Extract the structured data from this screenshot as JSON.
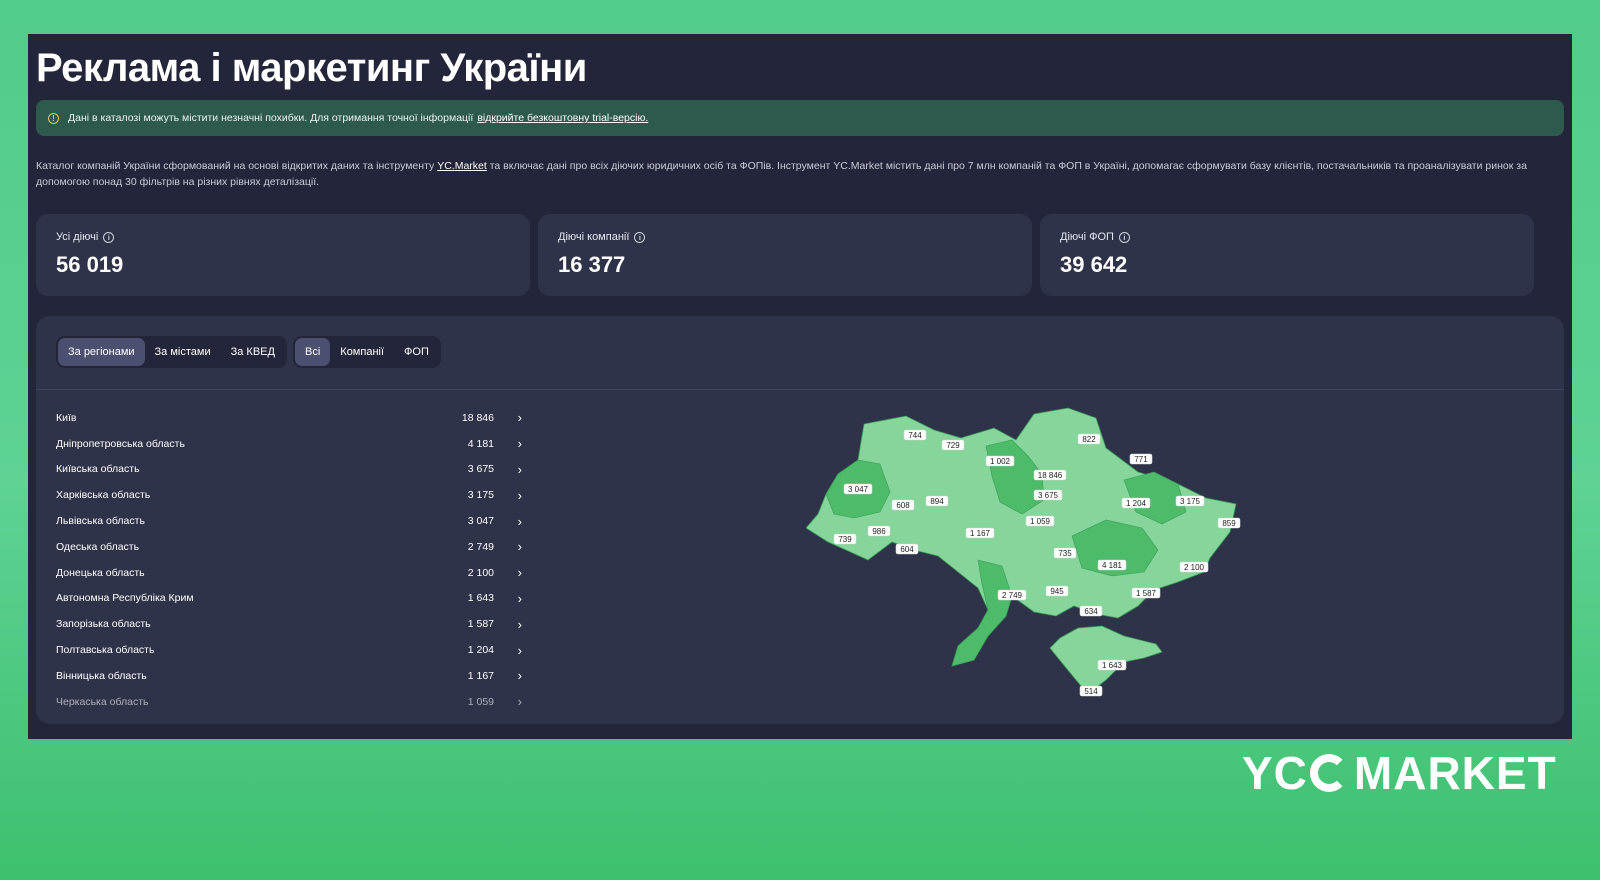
{
  "title": "Реклама і маркетинг України",
  "notice": {
    "text": "Дані в каталозі можуть містити незначні похибки. Для отримання точної інформації",
    "link": "відкрийте безкоштовну trial-версію."
  },
  "intro": {
    "before_link": "Каталог компаній України сформований на основі відкритих даних та інструменту",
    "link": "YC.Market",
    "after_link": "та включає дані про всіх діючих юридичних осіб та ФОПів. Інструмент YC.Market містить дані про 7 млн компаній та ФОП в Україні, допомагає сформувати базу клієнтів, постачальників та проаналізувати ринок за допомогою понад 30 фільтрів на різних рівнях деталізації."
  },
  "stats": [
    {
      "label": "Усі діючі",
      "value": "56 019"
    },
    {
      "label": "Діючі компанії",
      "value": "16 377"
    },
    {
      "label": "Діючі ФОП",
      "value": "39 642"
    }
  ],
  "tabs_group": [
    "За регіонами",
    "За містами",
    "За КВЕД"
  ],
  "filter_group": [
    "Всі",
    "Компанії",
    "ФОП"
  ],
  "regions": [
    {
      "name": "Київ",
      "count": "18 846"
    },
    {
      "name": "Дніпропетровська область",
      "count": "4 181"
    },
    {
      "name": "Київська область",
      "count": "3 675"
    },
    {
      "name": "Харківська область",
      "count": "3 175"
    },
    {
      "name": "Львівська область",
      "count": "3 047"
    },
    {
      "name": "Одеська область",
      "count": "2 749"
    },
    {
      "name": "Донецька область",
      "count": "2 100"
    },
    {
      "name": "Автономна Республіка Крим",
      "count": "1 643"
    },
    {
      "name": "Запорізька область",
      "count": "1 587"
    },
    {
      "name": "Полтавська область",
      "count": "1 204"
    },
    {
      "name": "Вінницька область",
      "count": "1 167"
    },
    {
      "name": "Черкаська область",
      "count": "1 059"
    }
  ],
  "map_labels": [
    "744",
    "729",
    "1 002",
    "18 846",
    "822",
    "771",
    "3 047",
    "608",
    "894",
    "3 675",
    "1 204",
    "3 175",
    "859",
    "739",
    "986",
    "604",
    "1 167",
    "1 059",
    "735",
    "4 181",
    "2 100",
    "2 749",
    "945",
    "1 587",
    "634",
    "1 643",
    "514"
  ],
  "colors": {
    "map_light": "#8fd8a2",
    "map_mid": "#6fcf88",
    "map_dark": "#4dbb6a",
    "accent_bg": "#52cc8a"
  },
  "logo": {
    "left": "YC",
    "right": "MARKET"
  }
}
